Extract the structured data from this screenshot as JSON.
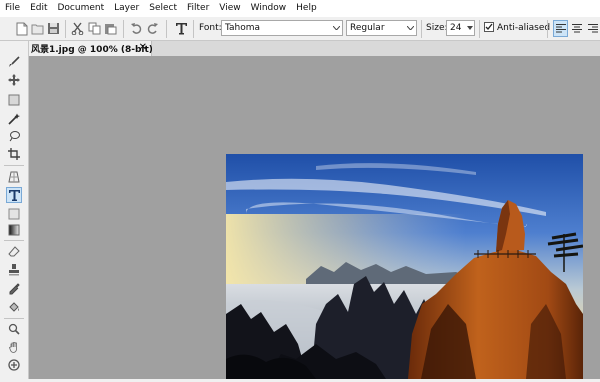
{
  "menubar": {
    "items": [
      "File",
      "Edit",
      "Document",
      "Layer",
      "Select",
      "Filter",
      "View",
      "Window",
      "Help"
    ]
  },
  "toolbar": {
    "font_label": "Font:",
    "font_value": "Tahoma",
    "style_value": "Regular",
    "size_label": "Size:",
    "size_value": "24",
    "antialias_label": "Anti-aliased",
    "antialias_checked": true,
    "icons": [
      "new-file-icon",
      "open-file-icon",
      "save-icon",
      "cut-icon",
      "copy-icon",
      "paste-icon",
      "undo-icon",
      "redo-icon",
      "text-tool-icon",
      "align-left-icon",
      "align-center-icon",
      "align-right-icon"
    ]
  },
  "tools": {
    "items": [
      "brush-icon",
      "move-icon",
      "rectangle-select-icon",
      "magic-wand-icon",
      "lasso-icon",
      "crop-icon",
      "perspective-icon",
      "text-icon",
      "shape-icon",
      "gradient-icon",
      "eraser-icon",
      "stamp-icon",
      "eyedropper-icon",
      "fill-icon",
      "zoom-icon",
      "hand-icon",
      "heal-icon"
    ],
    "active": "text-icon"
  },
  "document": {
    "tab_title": "风景1.jpg @ 100% (8-bit)",
    "close_glyph": "✕"
  },
  "colors": {
    "canvas_bg": "#a0a0a0",
    "accent": "#cde4f7"
  }
}
